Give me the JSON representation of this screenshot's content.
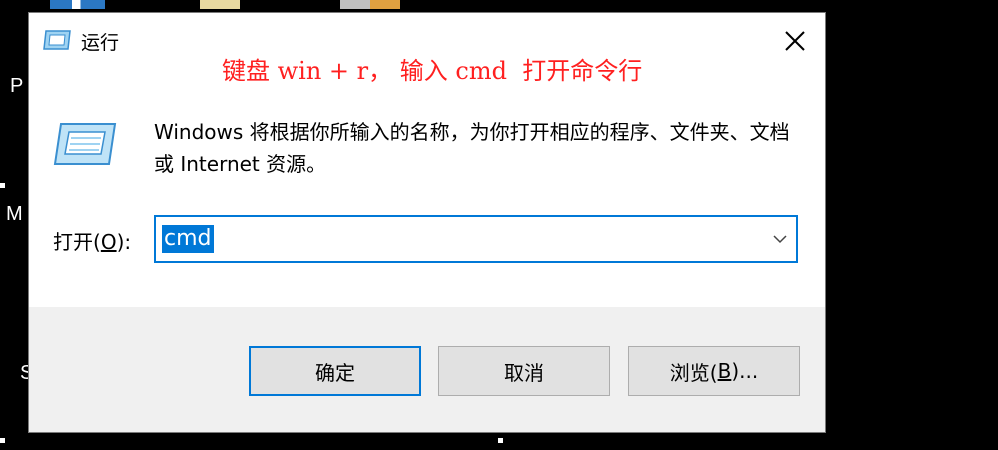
{
  "desktop": {
    "fragments": [
      "P",
      "M",
      "S"
    ]
  },
  "dialog": {
    "title": "运行",
    "annotation": "键盘 win + r， 输入 cmd  打开命令行",
    "description": "Windows 将根据你所输入的名称，为你打开相应的程序、文件夹、文档或 Internet 资源。",
    "open_label_prefix": "打开(",
    "open_label_key": "O",
    "open_label_suffix": "):",
    "input_value": "cmd",
    "buttons": {
      "ok": "确定",
      "cancel": "取消",
      "browse_prefix": "浏览(",
      "browse_key": "B",
      "browse_suffix": ")..."
    }
  },
  "icons": {
    "title": "run-app-icon",
    "large": "run-app-icon",
    "close": "close-icon",
    "dropdown": "chevron-down-icon"
  },
  "colors": {
    "accent": "#0078d7",
    "annotation": "#ff2020",
    "button_face": "#e1e1e1",
    "footer_bg": "#f0f0f0"
  }
}
